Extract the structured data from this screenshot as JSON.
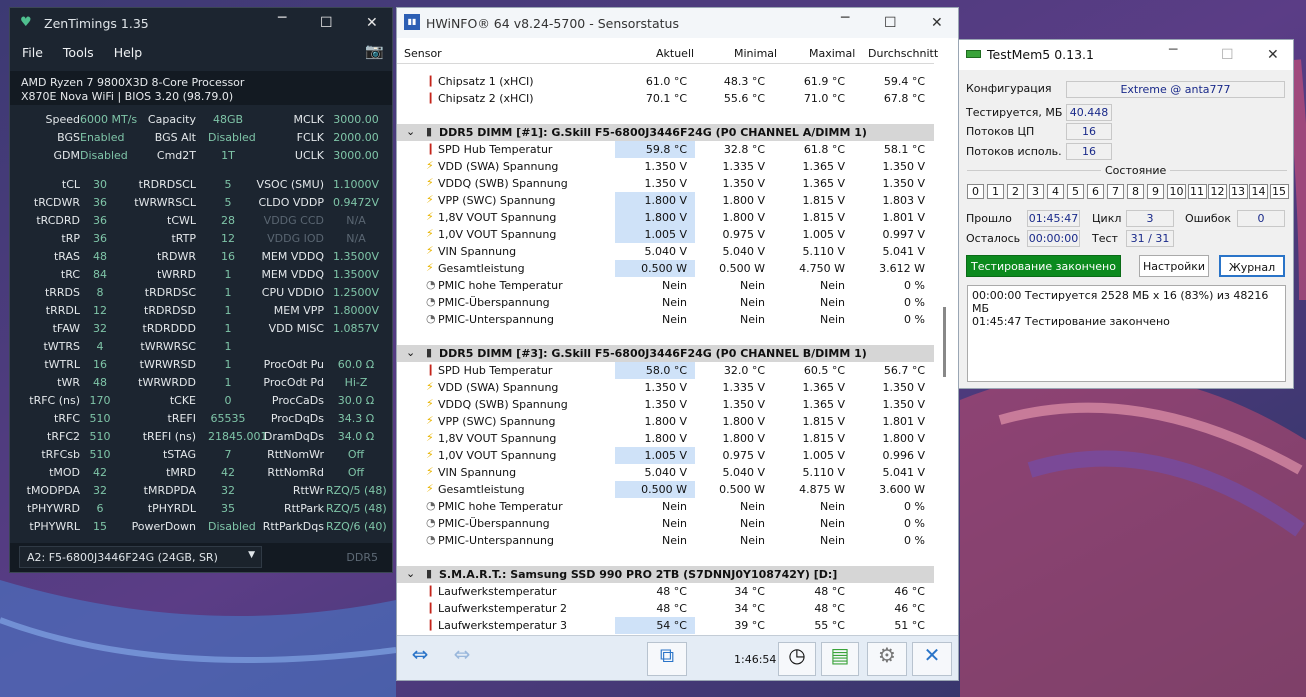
{
  "colors": {
    "zen_bg": "#1c2530",
    "zen_value": "#7fc5a8",
    "hw_highlight": "#cfe2f8",
    "tm_green": "#0c8a1e"
  },
  "zen": {
    "title": "ZenTimings 1.35",
    "menu": [
      "File",
      "Tools",
      "Help"
    ],
    "cpu_line1": "AMD Ryzen 7 9800X3D 8-Core Processor",
    "cpu_line2": "X870E Nova WiFi | BIOS 3.20 (98.79.0)",
    "top": [
      [
        "Speed",
        "6000 MT/s",
        "Capacity",
        "48GB",
        "MCLK",
        "3000.00"
      ],
      [
        "BGS",
        "Enabled",
        "BGS Alt",
        "Disabled",
        "FCLK",
        "2000.00"
      ],
      [
        "GDM",
        "Disabled",
        "Cmd2T",
        "1T",
        "UCLK",
        "3000.00"
      ]
    ],
    "rows": [
      [
        "tCL",
        "30",
        "tRDRDSCL",
        "5",
        "VSOC (SMU)",
        "1.1000V"
      ],
      [
        "tRCDWR",
        "36",
        "tWRWRSCL",
        "5",
        "CLDO VDDP",
        "0.9472V"
      ],
      [
        "tRCDRD",
        "36",
        "tCWL",
        "28",
        "VDDG CCD",
        "N/A"
      ],
      [
        "tRP",
        "36",
        "tRTP",
        "12",
        "VDDG IOD",
        "N/A"
      ],
      [
        "tRAS",
        "48",
        "tRDWR",
        "16",
        "MEM VDDQ",
        "1.3500V"
      ],
      [
        "tRC",
        "84",
        "tWRRD",
        "1",
        "MEM VDDQ",
        "1.3500V"
      ],
      [
        "tRRDS",
        "8",
        "tRDRDSC",
        "1",
        "CPU VDDIO",
        "1.2500V"
      ],
      [
        "tRRDL",
        "12",
        "tRDRDSD",
        "1",
        "MEM VPP",
        "1.8000V"
      ],
      [
        "tFAW",
        "32",
        "tRDRDDD",
        "1",
        "VDD MISC",
        "1.0857V"
      ],
      [
        "tWTRS",
        "4",
        "tWRWRSC",
        "1",
        "",
        ""
      ],
      [
        "tWTRL",
        "16",
        "tWRWRSD",
        "1",
        "ProcOdt Pu",
        "60.0 Ω"
      ],
      [
        "tWR",
        "48",
        "tWRWRDD",
        "1",
        "ProcOdt Pd",
        "Hi-Z"
      ],
      [
        "tRFC (ns)",
        "170",
        "tCKE",
        "0",
        "ProcCaDs",
        "30.0 Ω"
      ],
      [
        "tRFC",
        "510",
        "tREFI",
        "65535",
        "ProcDqDs",
        "34.3 Ω"
      ],
      [
        "tRFC2",
        "510",
        "tREFI (ns)",
        "21845.001",
        "DramDqDs",
        "34.0 Ω"
      ],
      [
        "tRFCsb",
        "510",
        "tSTAG",
        "7",
        "RttNomWr",
        "Off"
      ],
      [
        "tMOD",
        "42",
        "tMRD",
        "42",
        "RttNomRd",
        "Off"
      ],
      [
        "tMODPDA",
        "32",
        "tMRDPDA",
        "32",
        "RttWr",
        "RZQ/5 (48)"
      ],
      [
        "tPHYWRD",
        "6",
        "tPHYRDL",
        "35",
        "RttPark",
        "RZQ/5 (48)"
      ],
      [
        "tPHYWRL",
        "15",
        "PowerDown",
        "Disabled",
        "RttParkDqs",
        "RZQ/6 (40)"
      ]
    ],
    "module": "A2: F5-6800J3446F24G (24GB, SR)",
    "ddr": "DDR5"
  },
  "hw": {
    "title": "HWiNFO® 64 v8.24-5700 - Sensorstatus",
    "cols": [
      "Sensor",
      "Aktuell",
      "Minimal",
      "Maximal",
      "Durchschnitt"
    ],
    "clock": "1:46:54",
    "rows": [
      {
        "k": "r",
        "icon": "t",
        "name": "Chipsatz 1 (xHCI)",
        "v": [
          "61.0 °C",
          "48.3 °C",
          "61.9 °C",
          "59.4 °C"
        ]
      },
      {
        "k": "r",
        "icon": "t",
        "name": "Chipsatz 2 (xHCI)",
        "v": [
          "70.1 °C",
          "55.6 °C",
          "71.0 °C",
          "67.8 °C"
        ]
      },
      {
        "k": "gap"
      },
      {
        "k": "g",
        "name": "DDR5 DIMM [#1]: G.Skill F5-6800J3446F24G (P0 CHANNEL A/DIMM 1)"
      },
      {
        "k": "r",
        "icon": "t",
        "name": "SPD Hub Temperatur",
        "v": [
          "59.8 °C",
          "32.8 °C",
          "61.8 °C",
          "58.1 °C"
        ],
        "hl": true
      },
      {
        "k": "r",
        "icon": "v",
        "name": "VDD (SWA) Spannung",
        "v": [
          "1.350 V",
          "1.335 V",
          "1.365 V",
          "1.350 V"
        ]
      },
      {
        "k": "r",
        "icon": "v",
        "name": "VDDQ (SWB) Spannung",
        "v": [
          "1.350 V",
          "1.350 V",
          "1.365 V",
          "1.350 V"
        ]
      },
      {
        "k": "r",
        "icon": "v",
        "name": "VPP (SWC) Spannung",
        "v": [
          "1.800 V",
          "1.800 V",
          "1.815 V",
          "1.803 V"
        ],
        "hl": true
      },
      {
        "k": "r",
        "icon": "v",
        "name": "1,8V VOUT Spannung",
        "v": [
          "1.800 V",
          "1.800 V",
          "1.815 V",
          "1.801 V"
        ],
        "hl": true
      },
      {
        "k": "r",
        "icon": "v",
        "name": "1,0V VOUT Spannung",
        "v": [
          "1.005 V",
          "0.975 V",
          "1.005 V",
          "0.997 V"
        ],
        "hl": true
      },
      {
        "k": "r",
        "icon": "v",
        "name": "VIN Spannung",
        "v": [
          "5.040 V",
          "5.040 V",
          "5.110 V",
          "5.041 V"
        ]
      },
      {
        "k": "r",
        "icon": "v",
        "name": "Gesamtleistung",
        "v": [
          "0.500 W",
          "0.500 W",
          "4.750 W",
          "3.612 W"
        ],
        "hl": true
      },
      {
        "k": "r",
        "icon": "p",
        "name": "PMIC hohe Temperatur",
        "v": [
          "Nein",
          "Nein",
          "Nein",
          "0 %"
        ]
      },
      {
        "k": "r",
        "icon": "p",
        "name": "PMIC-Überspannung",
        "v": [
          "Nein",
          "Nein",
          "Nein",
          "0 %"
        ]
      },
      {
        "k": "r",
        "icon": "p",
        "name": "PMIC-Unterspannung",
        "v": [
          "Nein",
          "Nein",
          "Nein",
          "0 %"
        ]
      },
      {
        "k": "gap"
      },
      {
        "k": "g",
        "name": "DDR5 DIMM [#3]: G.Skill F5-6800J3446F24G (P0 CHANNEL B/DIMM 1)"
      },
      {
        "k": "r",
        "icon": "t",
        "name": "SPD Hub Temperatur",
        "v": [
          "58.0 °C",
          "32.0 °C",
          "60.5 °C",
          "56.7 °C"
        ],
        "hl": true
      },
      {
        "k": "r",
        "icon": "v",
        "name": "VDD (SWA) Spannung",
        "v": [
          "1.350 V",
          "1.335 V",
          "1.365 V",
          "1.350 V"
        ]
      },
      {
        "k": "r",
        "icon": "v",
        "name": "VDDQ (SWB) Spannung",
        "v": [
          "1.350 V",
          "1.350 V",
          "1.365 V",
          "1.350 V"
        ]
      },
      {
        "k": "r",
        "icon": "v",
        "name": "VPP (SWC) Spannung",
        "v": [
          "1.800 V",
          "1.800 V",
          "1.815 V",
          "1.801 V"
        ]
      },
      {
        "k": "r",
        "icon": "v",
        "name": "1,8V VOUT Spannung",
        "v": [
          "1.800 V",
          "1.800 V",
          "1.815 V",
          "1.800 V"
        ]
      },
      {
        "k": "r",
        "icon": "v",
        "name": "1,0V VOUT Spannung",
        "v": [
          "1.005 V",
          "0.975 V",
          "1.005 V",
          "0.996 V"
        ],
        "hl": true
      },
      {
        "k": "r",
        "icon": "v",
        "name": "VIN Spannung",
        "v": [
          "5.040 V",
          "5.040 V",
          "5.110 V",
          "5.041 V"
        ]
      },
      {
        "k": "r",
        "icon": "v",
        "name": "Gesamtleistung",
        "v": [
          "0.500 W",
          "0.500 W",
          "4.875 W",
          "3.600 W"
        ],
        "hl": true
      },
      {
        "k": "r",
        "icon": "p",
        "name": "PMIC hohe Temperatur",
        "v": [
          "Nein",
          "Nein",
          "Nein",
          "0 %"
        ]
      },
      {
        "k": "r",
        "icon": "p",
        "name": "PMIC-Überspannung",
        "v": [
          "Nein",
          "Nein",
          "Nein",
          "0 %"
        ]
      },
      {
        "k": "r",
        "icon": "p",
        "name": "PMIC-Unterspannung",
        "v": [
          "Nein",
          "Nein",
          "Nein",
          "0 %"
        ]
      },
      {
        "k": "gap"
      },
      {
        "k": "g",
        "name": "S.M.A.R.T.: Samsung SSD 990 PRO 2TB (S7DNNJ0Y108742Y) [D:]"
      },
      {
        "k": "r",
        "icon": "t",
        "name": "Laufwerkstemperatur",
        "v": [
          "48 °C",
          "34 °C",
          "48 °C",
          "46 °C"
        ]
      },
      {
        "k": "r",
        "icon": "t",
        "name": "Laufwerkstemperatur 2",
        "v": [
          "48 °C",
          "34 °C",
          "48 °C",
          "46 °C"
        ]
      },
      {
        "k": "r",
        "icon": "t",
        "name": "Laufwerkstemperatur 3",
        "v": [
          "54 °C",
          "39 °C",
          "55 °C",
          "51 °C"
        ],
        "hl": true
      }
    ]
  },
  "tm": {
    "title": "TestMem5  0.13.1",
    "cfg_label": "Конфигурация",
    "cfg_value": "Extreme @ anta777",
    "tested_label": "Тестируется, МБ",
    "tested_value": "40.448",
    "threads_label": "Потоков ЦП",
    "threads_value": "16",
    "used_label": "Потоков исполь.",
    "used_value": "16",
    "state_label": "Состояние",
    "cores": [
      "0",
      "1",
      "2",
      "3",
      "4",
      "5",
      "6",
      "7",
      "8",
      "9",
      "10",
      "11",
      "12",
      "13",
      "14",
      "15"
    ],
    "elapsed_label": "Прошло",
    "elapsed_value": "01:45:47",
    "cycle_label": "Цикл",
    "cycle_value": "3",
    "errors_label": "Ошибок",
    "errors_value": "0",
    "left_label": "Осталось",
    "left_value": "00:00:00",
    "test_label": "Тест",
    "test_value": "31 / 31",
    "status_btn": "Тестирование закончено",
    "settings_btn": "Настройки",
    "log_btn": "Журнал",
    "log": [
      "00:00:00  Тестируется 2528 МБ x 16 (83%) из 48216 МБ",
      "01:45:47  Тестирование закончено"
    ]
  }
}
